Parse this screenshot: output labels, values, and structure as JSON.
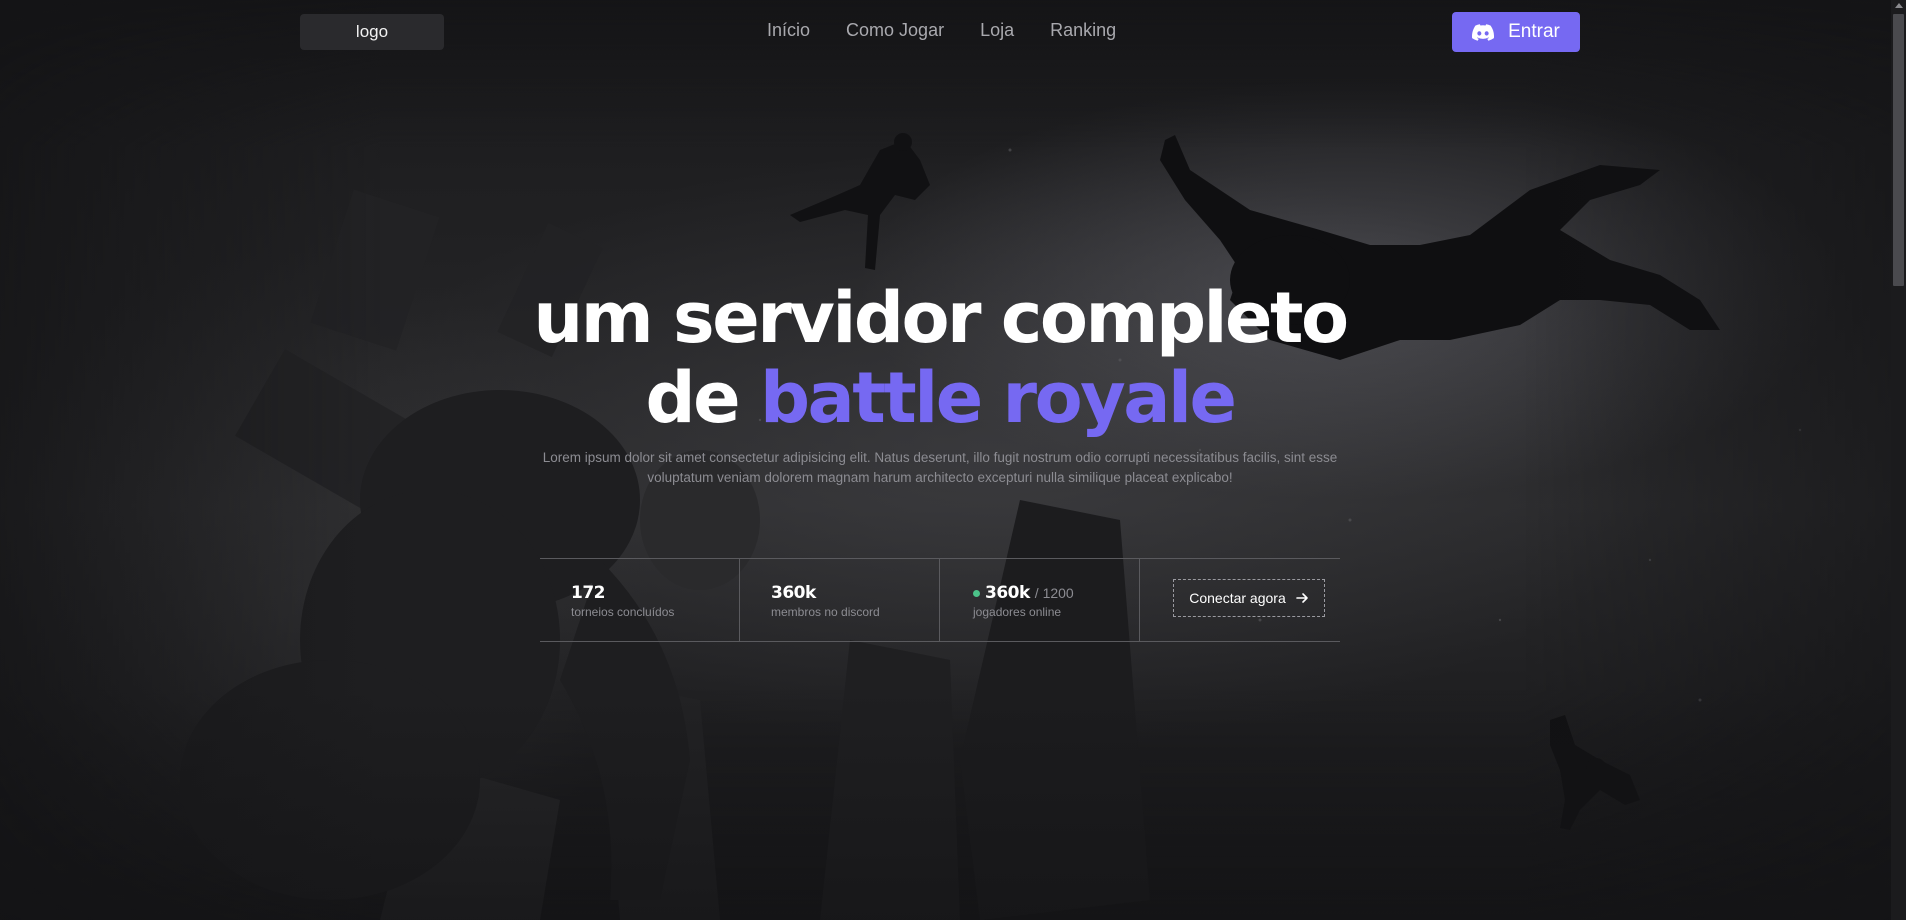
{
  "header": {
    "logo_text": "logo",
    "nav": [
      {
        "label": "Início"
      },
      {
        "label": "Como Jogar"
      },
      {
        "label": "Loja"
      },
      {
        "label": "Ranking"
      }
    ],
    "login_button": {
      "label": "Entrar",
      "icon": "discord-icon"
    }
  },
  "hero": {
    "title_line1": "um servidor completo",
    "title_line2_prefix": "de ",
    "title_line2_accent": "battle royale",
    "description": "Lorem ipsum dolor sit amet consectetur adipisicing elit. Natus deserunt, illo fugit nostrum odio corrupti necessitatibus facilis, sint esse voluptatum veniam dolorem magnam harum architecto excepturi nulla similique placeat explicabo!"
  },
  "stats": [
    {
      "value": "172",
      "label": "torneios concluídos"
    },
    {
      "value": "360k",
      "label": "membros no discord"
    },
    {
      "value": "360k",
      "total": "/ 1200",
      "label": "jogadores online",
      "status": "online"
    }
  ],
  "cta": {
    "label": "Conectar agora",
    "icon": "arrow-right-icon"
  },
  "colors": {
    "accent": "#7669f2",
    "online": "#4cc38a",
    "background": "#141416"
  }
}
